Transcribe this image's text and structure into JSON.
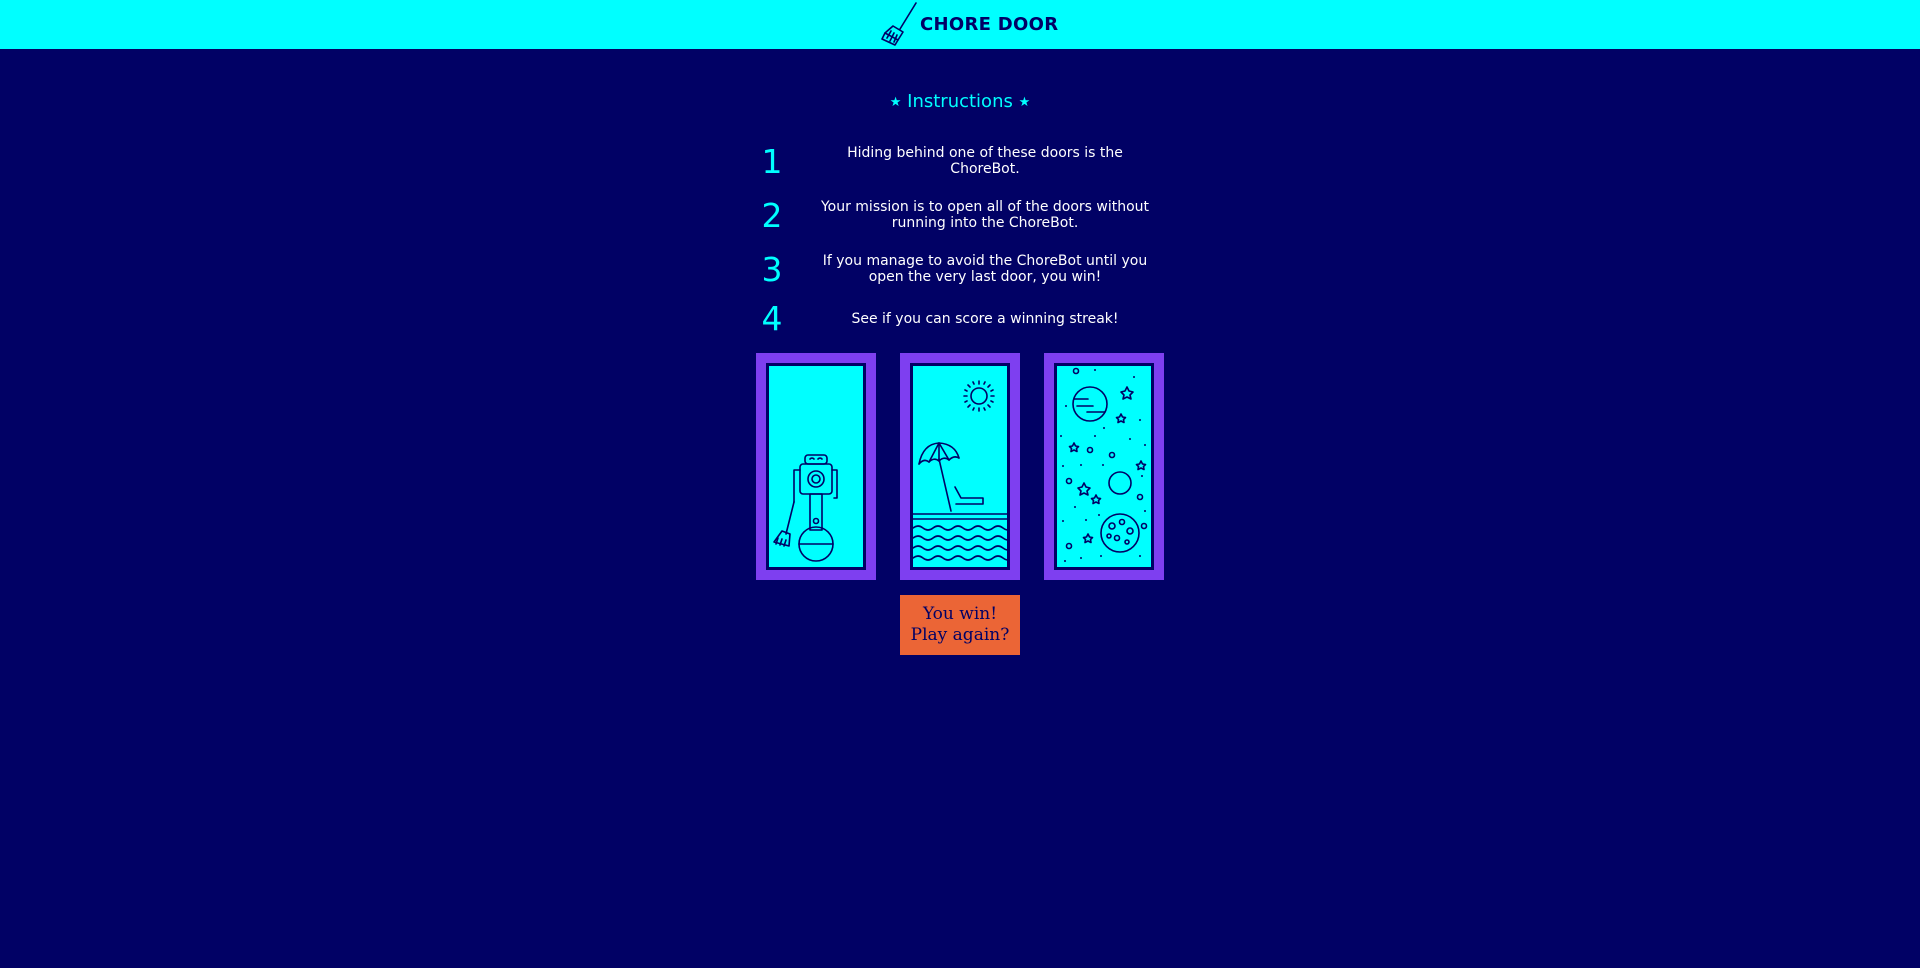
{
  "header": {
    "title": "CHORE DOOR",
    "icon": "broom-icon"
  },
  "instructions": {
    "star_left": "★",
    "title": "Instructions",
    "star_right": "★",
    "steps": [
      {
        "number": "1",
        "text": "Hiding behind one of these doors is the ChoreBot."
      },
      {
        "number": "2",
        "text": "Your mission is to open all of the doors without running into the ChoreBot."
      },
      {
        "number": "3",
        "text": "If you manage to avoid the ChoreBot until you open the very last door, you win!"
      },
      {
        "number": "4",
        "text": "See if you can score a winning streak!"
      }
    ]
  },
  "doors": [
    {
      "content": "robot-icon"
    },
    {
      "content": "beach-icon"
    },
    {
      "content": "space-icon"
    }
  ],
  "start_button": {
    "label": "You win! Play again?"
  },
  "colors": {
    "background": "#010165",
    "accent": "#00ffff",
    "door_frame": "#7e3ff0",
    "button": "#eb6536",
    "text": "#ffffff"
  }
}
